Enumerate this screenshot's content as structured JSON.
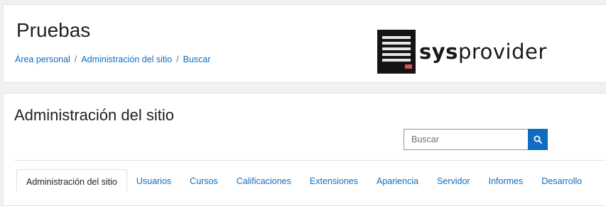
{
  "header": {
    "title": "Pruebas",
    "breadcrumb": [
      {
        "label": "Área personal"
      },
      {
        "label": "Administración del sitio"
      },
      {
        "label": "Buscar"
      }
    ],
    "breadcrumb_separator": "/",
    "logo": {
      "text_bold": "sys",
      "text_regular": "provider",
      "accent_color": "#d9534f"
    }
  },
  "admin": {
    "title": "Administración del sitio",
    "search": {
      "placeholder": "Buscar",
      "value": "",
      "icon": "search-icon"
    },
    "tabs": [
      {
        "label": "Administración del sitio",
        "active": true
      },
      {
        "label": "Usuarios",
        "active": false
      },
      {
        "label": "Cursos",
        "active": false
      },
      {
        "label": "Calificaciones",
        "active": false
      },
      {
        "label": "Extensiones",
        "active": false
      },
      {
        "label": "Apariencia",
        "active": false
      },
      {
        "label": "Servidor",
        "active": false
      },
      {
        "label": "Informes",
        "active": false
      },
      {
        "label": "Desarrollo",
        "active": false
      }
    ]
  },
  "colors": {
    "link": "#0f6cbf",
    "primary_button": "#0f6cbf",
    "page_background": "#f1f1f1"
  }
}
